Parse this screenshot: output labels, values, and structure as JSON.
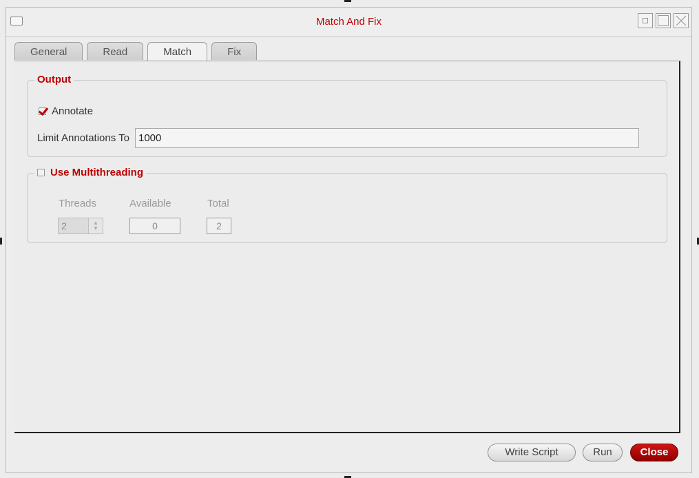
{
  "window": {
    "title": "Match And Fix"
  },
  "tabs": [
    {
      "label": "General",
      "active": false
    },
    {
      "label": "Read",
      "active": false
    },
    {
      "label": "Match",
      "active": true
    },
    {
      "label": "Fix",
      "active": false
    }
  ],
  "output": {
    "title": "Output",
    "annotate_label": "Annotate",
    "annotate_checked": true,
    "limit_label": "Limit Annotations To",
    "limit_value": "1000"
  },
  "multithreading": {
    "title": "Use Multithreading",
    "enabled": false,
    "threads_label": "Threads",
    "threads_value": "2",
    "available_label": "Available",
    "available_value": "0",
    "total_label": "Total",
    "total_value": "2"
  },
  "buttons": {
    "write_script": "Write Script",
    "run": "Run",
    "close": "Close"
  },
  "colors": {
    "accent": "#c00000",
    "close_button": "#b00000"
  }
}
